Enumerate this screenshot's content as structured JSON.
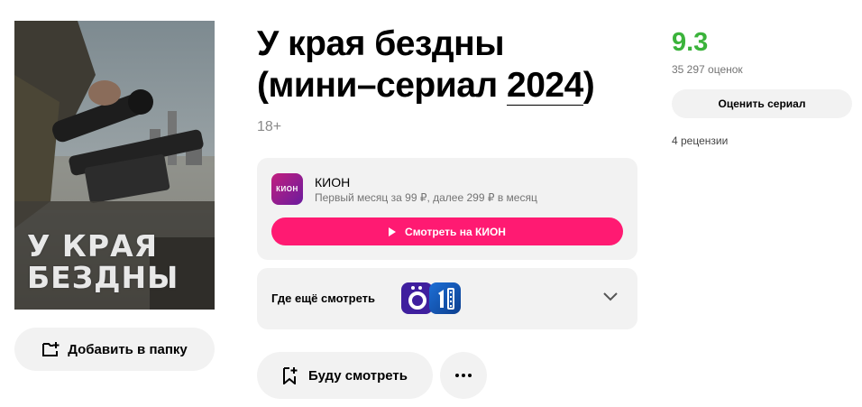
{
  "poster": {
    "title_text": "У КРАЯ\nБЕЗДНЫ"
  },
  "actions": {
    "add_to_folder": "Добавить в папку",
    "watch_later": "Буду смотреть"
  },
  "title": {
    "main": "У края бездны",
    "type_prefix": "(мини–сериал ",
    "year": "2024",
    "suffix": ")"
  },
  "age_rating": "18+",
  "provider": {
    "logo_text": "КИОН",
    "name": "КИОН",
    "offer": "Первый месяц за 99 ₽, далее 299 ₽ в месяц",
    "watch_button": "Смотреть на КИОН",
    "accent_color": "#ff1a72"
  },
  "where_else": {
    "label": "Где ещё смотреть",
    "services": [
      "okko-icon",
      "first-channel-icon"
    ]
  },
  "rating": {
    "value": "9.3",
    "votes": "35 297 оценок",
    "rate_button": "Оценить сериал",
    "reviews": "4 рецензии",
    "color": "#3bb33b"
  }
}
